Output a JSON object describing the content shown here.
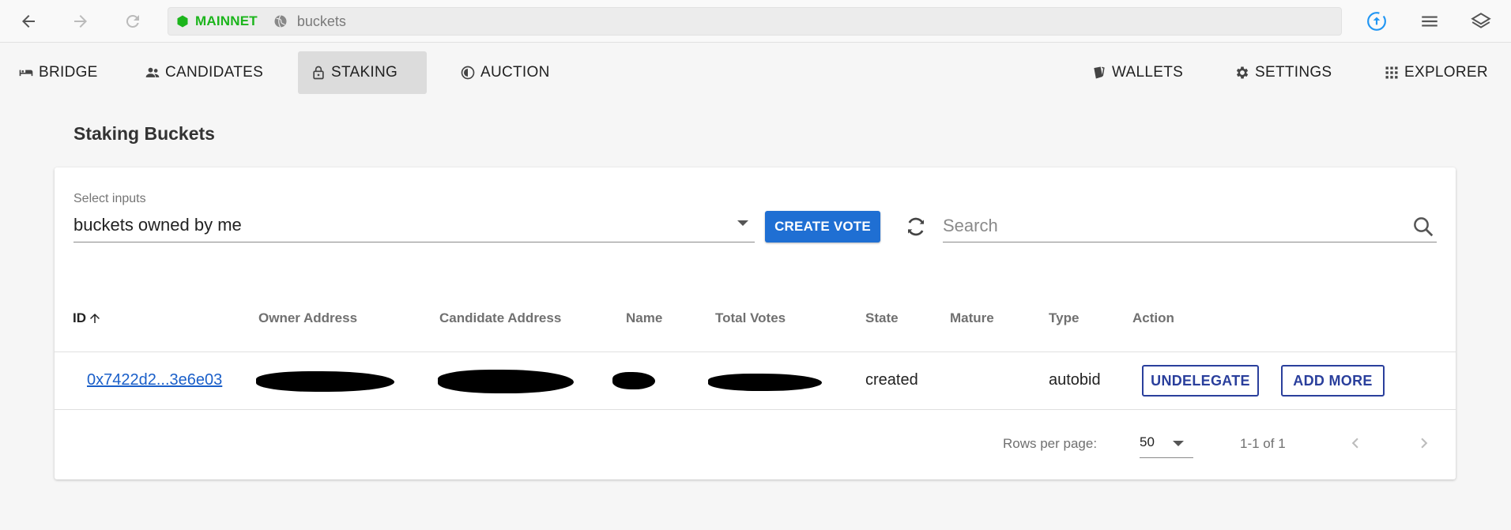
{
  "browser": {
    "network_label": "MAINNET",
    "url": "buckets",
    "icons": {
      "back": "arrow-left-icon",
      "forward": "arrow-right-icon",
      "reload": "reload-icon",
      "upload": "upload-circle-icon",
      "menu": "hamburger-menu-icon",
      "layers": "layers-icon"
    }
  },
  "nav": {
    "left": [
      {
        "label": "BRIDGE",
        "icon": "bridge-icon"
      },
      {
        "label": "CANDIDATES",
        "icon": "people-icon"
      },
      {
        "label": "STAKING",
        "icon": "lock-icon",
        "active": true
      },
      {
        "label": "AUCTION",
        "icon": "auction-icon"
      }
    ],
    "right": [
      {
        "label": "WALLETS",
        "icon": "wallet-icon"
      },
      {
        "label": "SETTINGS",
        "icon": "gear-icon"
      },
      {
        "label": "EXPLORER",
        "icon": "grid-icon"
      }
    ]
  },
  "page": {
    "title": "Staking Buckets"
  },
  "filters": {
    "select_label": "Select inputs",
    "select_value": "buckets owned by me",
    "create_vote_label": "CREATE VOTE",
    "search_placeholder": "Search"
  },
  "table": {
    "columns": [
      "ID",
      "Owner Address",
      "Candidate Address",
      "Name",
      "Total Votes",
      "State",
      "Mature",
      "Type",
      "Action"
    ],
    "sort_column": "ID",
    "sort_direction": "ascending",
    "rows": [
      {
        "id": "0x7422d2...3e6e03",
        "owner_address": "",
        "candidate_address": "",
        "name": "",
        "total_votes": "",
        "state": "created",
        "mature": "",
        "type": "autobid",
        "actions": [
          "UNDELEGATE",
          "ADD MORE"
        ]
      }
    ]
  },
  "pagination": {
    "rows_per_page_label": "Rows per page:",
    "rows_per_page": "50",
    "range": "1-1 of 1"
  },
  "colors": {
    "network": "#1cb51c",
    "primary": "#1f6fd3",
    "outline_button": "#2a3f9c",
    "link": "#1a5fc9"
  }
}
